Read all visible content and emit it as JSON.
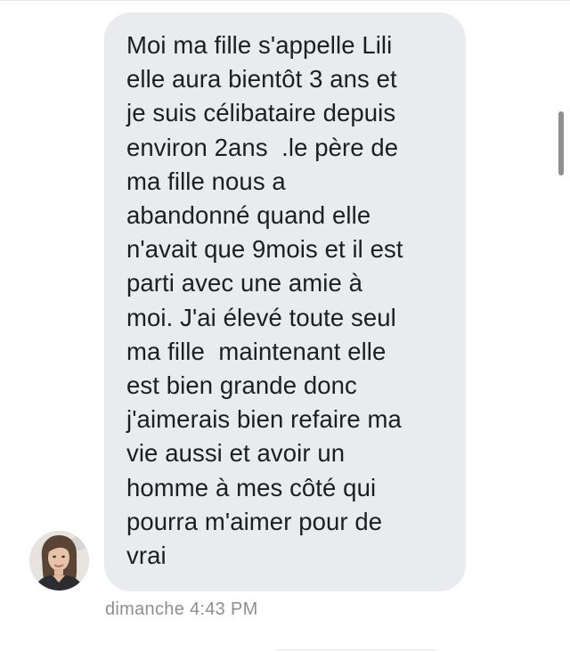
{
  "message": {
    "lines": [
      "Moi ma fille s'appelle Lili",
      "elle aura bientôt 3 ans et",
      "je suis célibataire depuis",
      "environ 2ans  .le père de",
      "ma fille nous a",
      "abandonné quand elle",
      "n'avait que 9mois et il est",
      "parti avec une amie à",
      "moi. J'ai élevé toute seul",
      "ma fille  maintenant elle",
      "est bien grande donc",
      "j'aimerais bien refaire ma",
      "vie aussi et avoir un",
      "homme à mes côté qui",
      "pourra m'aimer pour de",
      "vrai"
    ],
    "timestamp": "dimanche 4:43 PM"
  },
  "colors": {
    "bubble": "#e9ebee",
    "text": "#1c1e21",
    "timestamp": "#8b8d91"
  },
  "icons": {
    "avatar": "sender-avatar-photo"
  }
}
